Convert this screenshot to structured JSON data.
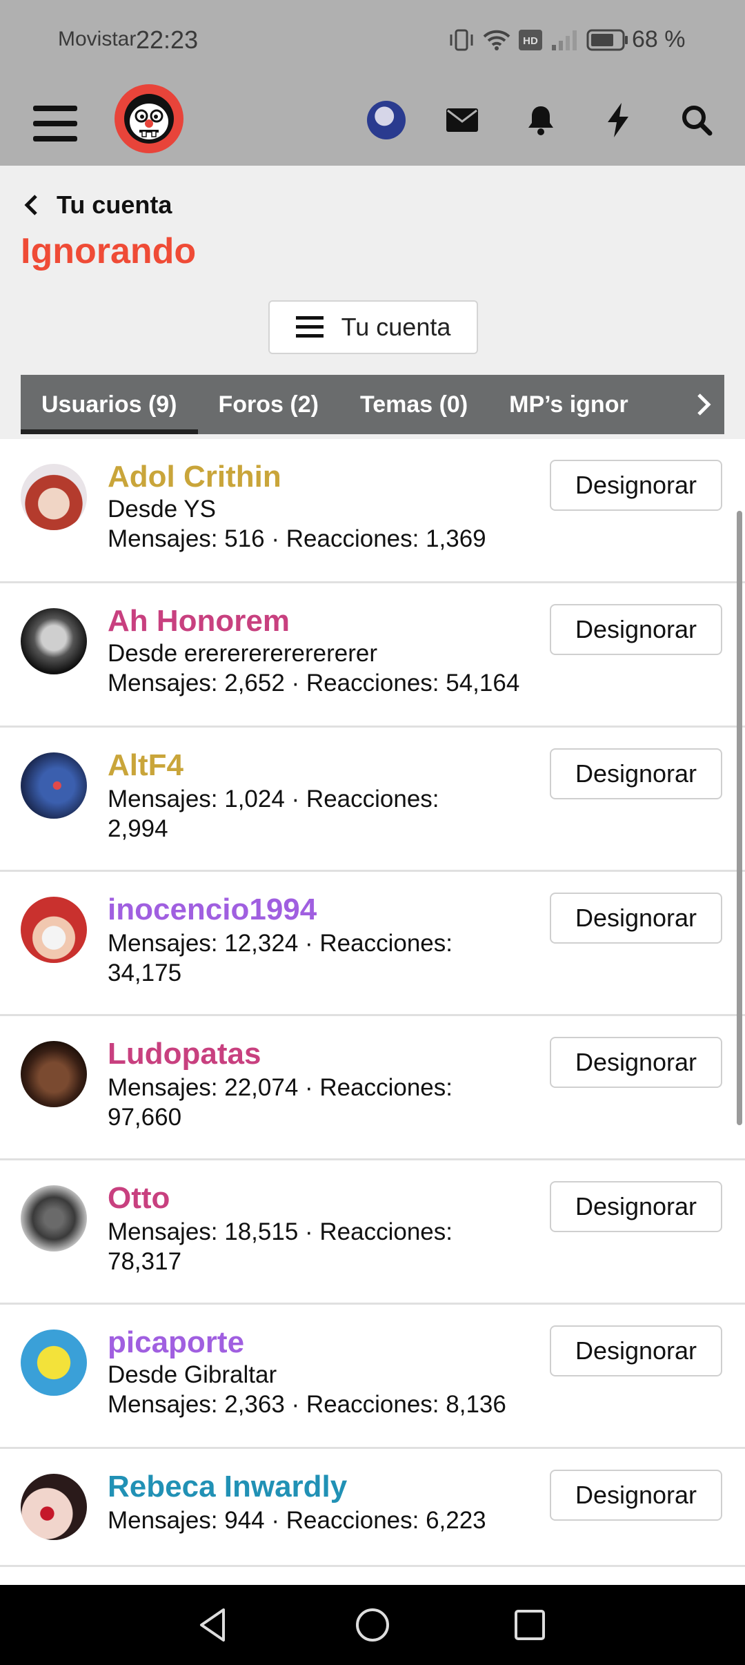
{
  "status_bar": {
    "carrier": "Movistar",
    "time": "22:23",
    "battery": "68 %"
  },
  "header": {
    "icons": [
      "menu-icon",
      "logo",
      "profile-avatar",
      "mail-icon",
      "bell-icon",
      "lightning-icon",
      "search-icon"
    ]
  },
  "page": {
    "back_label": "Tu cuenta",
    "title": "Ignorando",
    "account_button": "Tu cuenta"
  },
  "tabs": [
    "Usuarios (9)",
    "Foros (2)",
    "Temas (0)",
    "MP’s ignor"
  ],
  "unignore_label": "Designorar",
  "users": [
    {
      "name": "Adol Crithin",
      "color": "#c9a53a",
      "location": "Desde YS",
      "stats": "Mensajes: 516 · Reacciones: 1,369"
    },
    {
      "name": "Ah Honorem",
      "color": "#c8407f",
      "location": "Desde ererererererererer",
      "stats": "Mensajes: 2,652 · Reacciones: 54,164"
    },
    {
      "name": "AltF4",
      "color": "#c9a53a",
      "location": "",
      "stats": "Mensajes: 1,024 · Reacciones: 2,994"
    },
    {
      "name": "inocencio1994",
      "color": "#a05fe0",
      "location": "",
      "stats": "Mensajes: 12,324 · Reacciones: 34,175"
    },
    {
      "name": "Ludopatas",
      "color": "#c8407f",
      "location": "",
      "stats": "Mensajes: 22,074 · Reacciones: 97,660"
    },
    {
      "name": "Otto",
      "color": "#c8407f",
      "location": "",
      "stats": "Mensajes: 18,515 · Reacciones: 78,317"
    },
    {
      "name": "picaporte",
      "color": "#a05fe0",
      "location": "Desde Gibraltar",
      "stats": "Mensajes: 2,363 · Reacciones: 8,136"
    },
    {
      "name": "Rebeca Inwardly",
      "color": "#2191b5",
      "location": "",
      "stats": "Mensajes: 944 · Reacciones: 6,223"
    }
  ],
  "colors": {
    "accent": "#ef4b36",
    "header_bg": "#b0b0b0",
    "tab_bg": "#6a6c6d"
  }
}
